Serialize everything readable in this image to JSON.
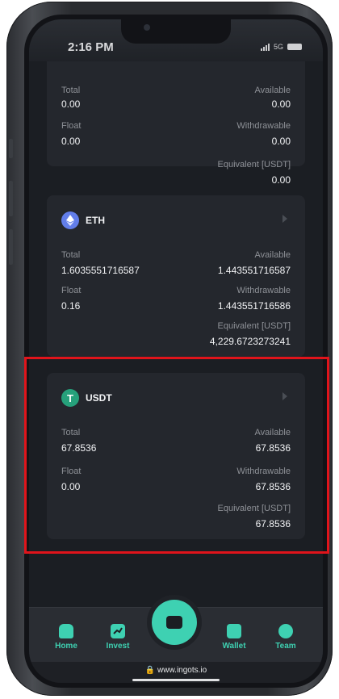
{
  "status_bar": {
    "time": "2:16 PM",
    "network": "5G"
  },
  "cards": [
    {
      "coin": "",
      "total_label": "Total",
      "total": "0.00",
      "available_label": "Available",
      "available": "0.00",
      "float_label": "Float",
      "float": "0.00",
      "withdrawable_label": "Withdrawable",
      "withdrawable": "0.00",
      "equivalent_label": "Equivalent [USDT]",
      "equivalent": "0.00"
    },
    {
      "coin": "ETH",
      "total_label": "Total",
      "total": "1.6035551716587",
      "available_label": "Available",
      "available": "1.443551716587",
      "float_label": "Float",
      "float": "0.16",
      "withdrawable_label": "Withdrawable",
      "withdrawable": "1.443551716586",
      "equivalent_label": "Equivalent [USDT]",
      "equivalent": "4,229.6723273241"
    },
    {
      "coin": "USDT",
      "total_label": "Total",
      "total": "67.8536",
      "available_label": "Available",
      "available": "67.8536",
      "float_label": "Float",
      "float": "0.00",
      "withdrawable_label": "Withdrawable",
      "withdrawable": "67.8536",
      "equivalent_label": "Equivalent [USDT]",
      "equivalent": "67.8536"
    }
  ],
  "nav": {
    "home": "Home",
    "invest": "Invest",
    "wallet": "Wallet",
    "team": "Team"
  },
  "url": "www.ingots.io",
  "colors": {
    "accent": "#3ed1b2",
    "eth": "#627eea",
    "usdt": "#26a17b",
    "highlight": "#e0141b"
  },
  "icons": {
    "eth": "ethereum-icon",
    "usdt": "tether-icon",
    "home": "home-icon",
    "invest": "chart-icon",
    "center": "exchange-icon",
    "wallet": "wallet-icon",
    "team": "team-icon",
    "lock": "lock-icon"
  }
}
